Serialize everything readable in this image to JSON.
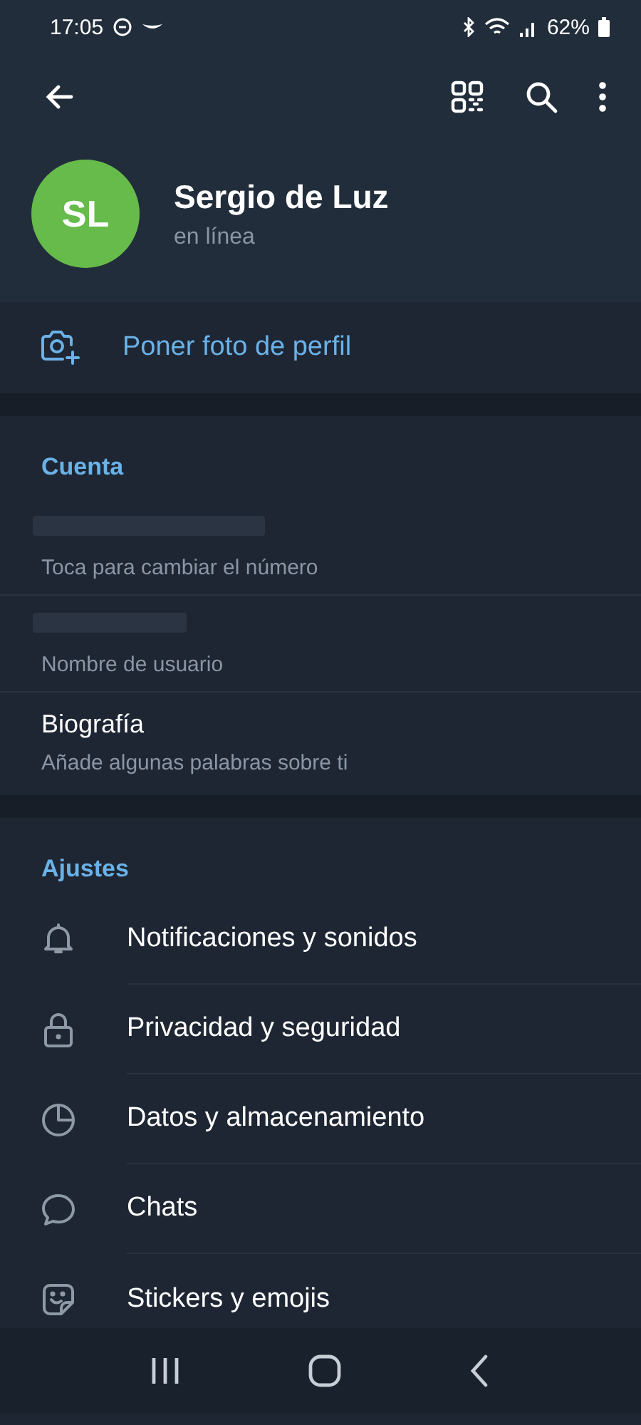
{
  "status_bar": {
    "time": "17:05",
    "battery": "62%"
  },
  "profile": {
    "initials": "SL",
    "name": "Sergio de Luz",
    "status": "en línea"
  },
  "set_photo": {
    "label": "Poner foto de perfil"
  },
  "account": {
    "title": "Cuenta",
    "rows": [
      {
        "kind": "redacted",
        "subtitle": "Toca para cambiar el número"
      },
      {
        "kind": "redacted",
        "subtitle": "Nombre de usuario"
      },
      {
        "kind": "text",
        "title": "Biografía",
        "subtitle": "Añade algunas palabras sobre ti"
      }
    ]
  },
  "settings": {
    "title": "Ajustes",
    "items": [
      {
        "label": "Notificaciones y sonidos"
      },
      {
        "label": "Privacidad y seguridad"
      },
      {
        "label": "Datos y almacenamiento"
      },
      {
        "label": "Chats"
      },
      {
        "label": "Stickers y emojis"
      }
    ]
  }
}
